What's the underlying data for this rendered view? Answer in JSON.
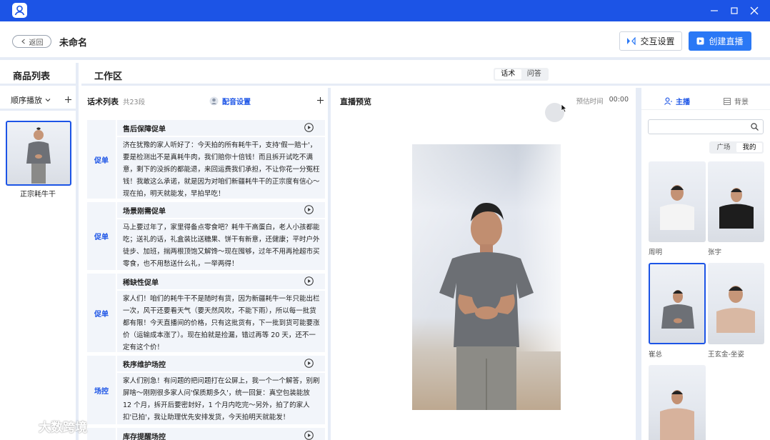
{
  "titlebar": {
    "bg": "#1c54e6"
  },
  "header": {
    "back_label": "返回",
    "title": "未命名",
    "interact_label": "交互设置",
    "create_label": "创建直播"
  },
  "products": {
    "title": "商品列表",
    "order_label": "顺序播放",
    "items": [
      {
        "name": "正宗耗牛干"
      }
    ]
  },
  "workarea": {
    "title": "工作区",
    "tabs": [
      {
        "label": "话术",
        "active": true
      },
      {
        "label": "问答",
        "active": false
      }
    ]
  },
  "scripts": {
    "title": "话术列表",
    "count": "共23段",
    "voice_label": "配音设置",
    "items": [
      {
        "tag": "促单",
        "title": "售后保障促单",
        "text": "济在犹豫的家人听好了：今天拍的所有耗牛干，支持'假一赔十'，要是检测出不是真耗牛肉，我们赔你十倍钱！而且拆开试吃不满意，剩下的没拆的都能退，来回运费我们承担，不让你花一分冤枉钱！我敢这么承诺，就是因为对咱们新疆耗牛干的正宗度有信心～现在拍，明天就能发，早拍早吃！"
      },
      {
        "tag": "促单",
        "title": "场景刚需促单",
        "text": "马上要过年了，家里得备点零食吧？耗牛干高蛋白，老人小孩都能吃；送礼的话，礼盒装比送糖果、饼干有新意，还健康；平时户外徒步、加班，揣两根顶饱又解馋～现在囤够，过年不用再抢超市买零食，也不用愁送什么礼，一举两得！"
      },
      {
        "tag": "促单",
        "title": "稀缺性促单",
        "text": "家人们！咱们的耗牛干不是随时有货，因为新疆耗牛一年只能出栏一次，风干还要看天气（要天然风吹，不能下雨），所以每一批货都有限！今天直播间的价格，只有这批货有，下一批到货可能要涨价（运输成本涨了）。现在拍就是捡漏，错过再等 20 天，还不一定有这个价！"
      },
      {
        "tag": "场控",
        "title": "秩序维护场控",
        "text": "家人们别急！有问题的把问题打在公屏上，我一个一个解答，别刷屏啥～刚刚很多家人问'保质期多久'，统一回复：真空包装能放 12 个月，拆开后要密封好，1 个月内吃完～另外，拍了的家人扣'已拍'，我让助理优先安排发货，今天拍明天就能发！"
      },
      {
        "tag": "",
        "title": "库存提醒场控",
        "text": ""
      }
    ]
  },
  "preview": {
    "title": "直播预览",
    "time_label": "预估时间",
    "time_value": "00:00"
  },
  "right_panel": {
    "tabs": [
      {
        "label": "主播",
        "active": true
      },
      {
        "label": "背景",
        "active": false
      }
    ],
    "search_placeholder": "",
    "filters": [
      {
        "label": "广场",
        "active": false
      },
      {
        "label": "我的",
        "active": true
      }
    ],
    "anchors": [
      {
        "name": "周明",
        "shirt": "#f4f4f4",
        "selected": false
      },
      {
        "name": "张宇",
        "shirt": "#1d1d1d",
        "selected": false
      },
      {
        "name": "崔总",
        "shirt": "#6d7076",
        "selected": true
      },
      {
        "name": "王玄金-坐姿",
        "shirt": "#d9b8a3",
        "selected": false
      },
      {
        "name": "",
        "shirt": "#d7b29c",
        "selected": false
      }
    ]
  },
  "watermark": {
    "text": "大数跨境"
  },
  "colors": {
    "accent": "#1c54e6",
    "button_blue": "#2a78f5",
    "panel_bg": "#f2f5fa"
  }
}
